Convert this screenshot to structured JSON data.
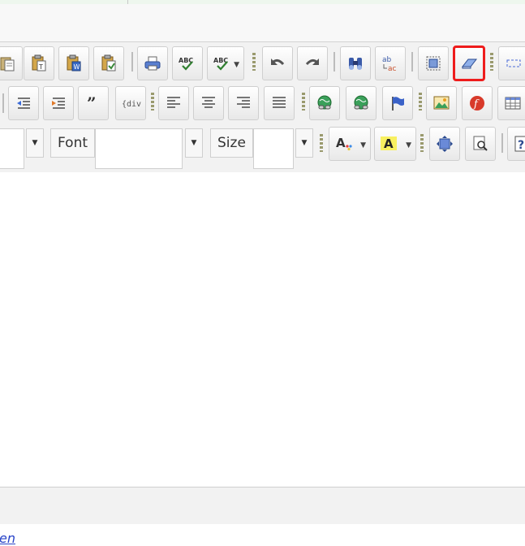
{
  "toolbar": {
    "font_label": "Font",
    "font_value": "",
    "size_label": "Size",
    "size_value": "",
    "format_value": ""
  },
  "bottom_link": "en",
  "colors": {
    "highlight": "#ee1c1c",
    "toolbar_bg": "#f2f2f2"
  }
}
